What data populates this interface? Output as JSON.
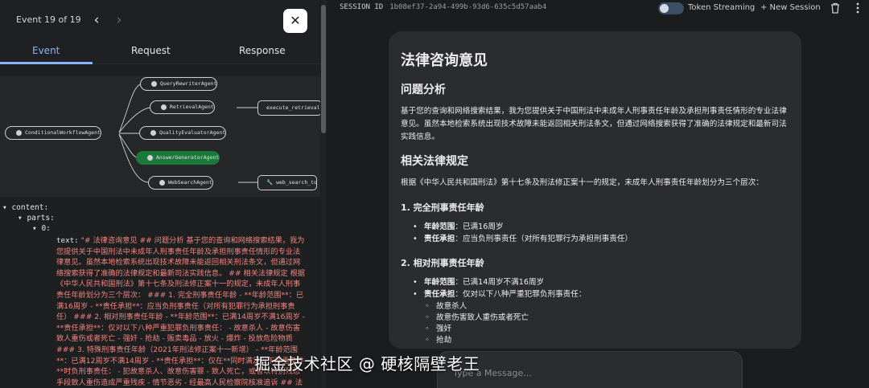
{
  "event_panel": {
    "counter": "Event 19 of 19",
    "prev_icon": "‹",
    "next_icon": "›",
    "close_icon": "✕",
    "tabs": [
      {
        "label": "Event"
      },
      {
        "label": "Request"
      },
      {
        "label": "Response"
      }
    ],
    "graph": {
      "nodes": [
        {
          "label": "QueryRewriterAgent"
        },
        {
          "label": "RetrievalAgent"
        },
        {
          "label": "ConditionalWorkflowAgent"
        },
        {
          "label": "QualityEvaluatorAgent"
        },
        {
          "label": "AnswerGeneratorAgent"
        },
        {
          "label": "WebSearchAgent"
        }
      ],
      "tools": [
        {
          "label": "execute_retrieval"
        },
        {
          "label": "web_search_tool"
        }
      ]
    },
    "json": {
      "content_key": "content:",
      "parts_key": "parts:",
      "index_key": "0:",
      "text_key": "text:",
      "text_value": "\"# 法律咨询意见 ## 问题分析 基于您的查询和网络搜索结果，我为您提供关于中国刑法中未成年人刑事责任年龄及承担刑事责任情形的专业法律意见。虽然本地检索系统出现技术故障未能返回相关刑法条文，但通过网络搜索获得了准确的法律规定和最新司法实践信息。 ## 相关法律规定 根据《中华人民共和国刑法》第十七条及刑法修正案十一的规定，未成年人刑事责任年龄划分为三个层次： ### 1. 完全刑事责任年龄 - **年龄范围**：已满16周岁 - **责任承担**：应当负刑事责任（对所有犯罪行为承担刑事责任） ### 2. 相对刑事责任年龄 - **年龄范围**：已满14周岁不满16周岁 - **责任承担**：仅对以下八种严重犯罪负刑事责任： - 故意杀人 - 故意伤害致人重伤或者死亡 - 强奸 - 抢劫 - 贩卖毒品 - 放火 - 爆炸 - 投放危险物质 ### 3. 特殊刑事责任年龄（2021年刑法修正案十一新增） - **年龄范围**：已满12周岁不满14周岁 - **责任承担**：仅在**同时满足以下严重条件**时负刑事责任： - 犯故意杀人、故意伤害罪 - 致人死亡，或者以特别残忍手段致人重伤造成严重残疾 - 情节恶劣 - 经最高人民检察院核准追诉 ## 法律解释 ###"
    },
    "scroll": {
      "fraction": 0.35
    }
  },
  "header": {
    "session_label": "SESSION ID",
    "session_id": "1b08ef37-2a94-499b-93d6-635c5d57aab4",
    "toggle_label": "Token Streaming",
    "toggle_on": false,
    "new_session_label": "+ New Session",
    "trash_icon": "trash-icon",
    "menu_icon": "kebab-menu-icon"
  },
  "answer": {
    "title": "法律咨询意见",
    "section1_title": "问题分析",
    "section1_body": "基于您的查询和网络搜索结果，我为您提供关于中国刑法中未成年人刑事责任年龄及承担刑事责任情形的专业法律意见。虽然本地检索系统出现技术故障未能返回相关刑法条文，但通过网络搜索获得了准确的法律规定和最新司法实践信息。",
    "section2_title": "相关法律规定",
    "section2_intro": "根据《中华人民共和国刑法》第十七条及刑法修正案十一的规定，未成年人刑事责任年龄划分为三个层次：",
    "sub1_title": "1. 完全刑事责任年龄",
    "sub1_items": [
      {
        "label": "年龄范围",
        "text": "：已满16周岁"
      },
      {
        "label": "责任承担",
        "text": "：应当负刑事责任（对所有犯罪行为承担刑事责任）"
      }
    ],
    "sub2_title": "2. 相对刑事责任年龄",
    "sub2_items": [
      {
        "label": "年龄范围",
        "text": "：已满14周岁不满16周岁"
      },
      {
        "label": "责任承担",
        "text": "：仅对以下八种严重犯罪负刑事责任："
      }
    ],
    "sub2_crimes": [
      "故意杀人",
      "故意伤害致人重伤或者死亡",
      "强奸",
      "抢劫"
    ]
  },
  "input": {
    "placeholder": "Type a Message..."
  },
  "watermark": "掘金技术社区 @ 硬核隔壁老王",
  "colors": {
    "accent": "#8ab4f8",
    "json_string": "#f0857d",
    "active_node": "#1b7a3a"
  }
}
